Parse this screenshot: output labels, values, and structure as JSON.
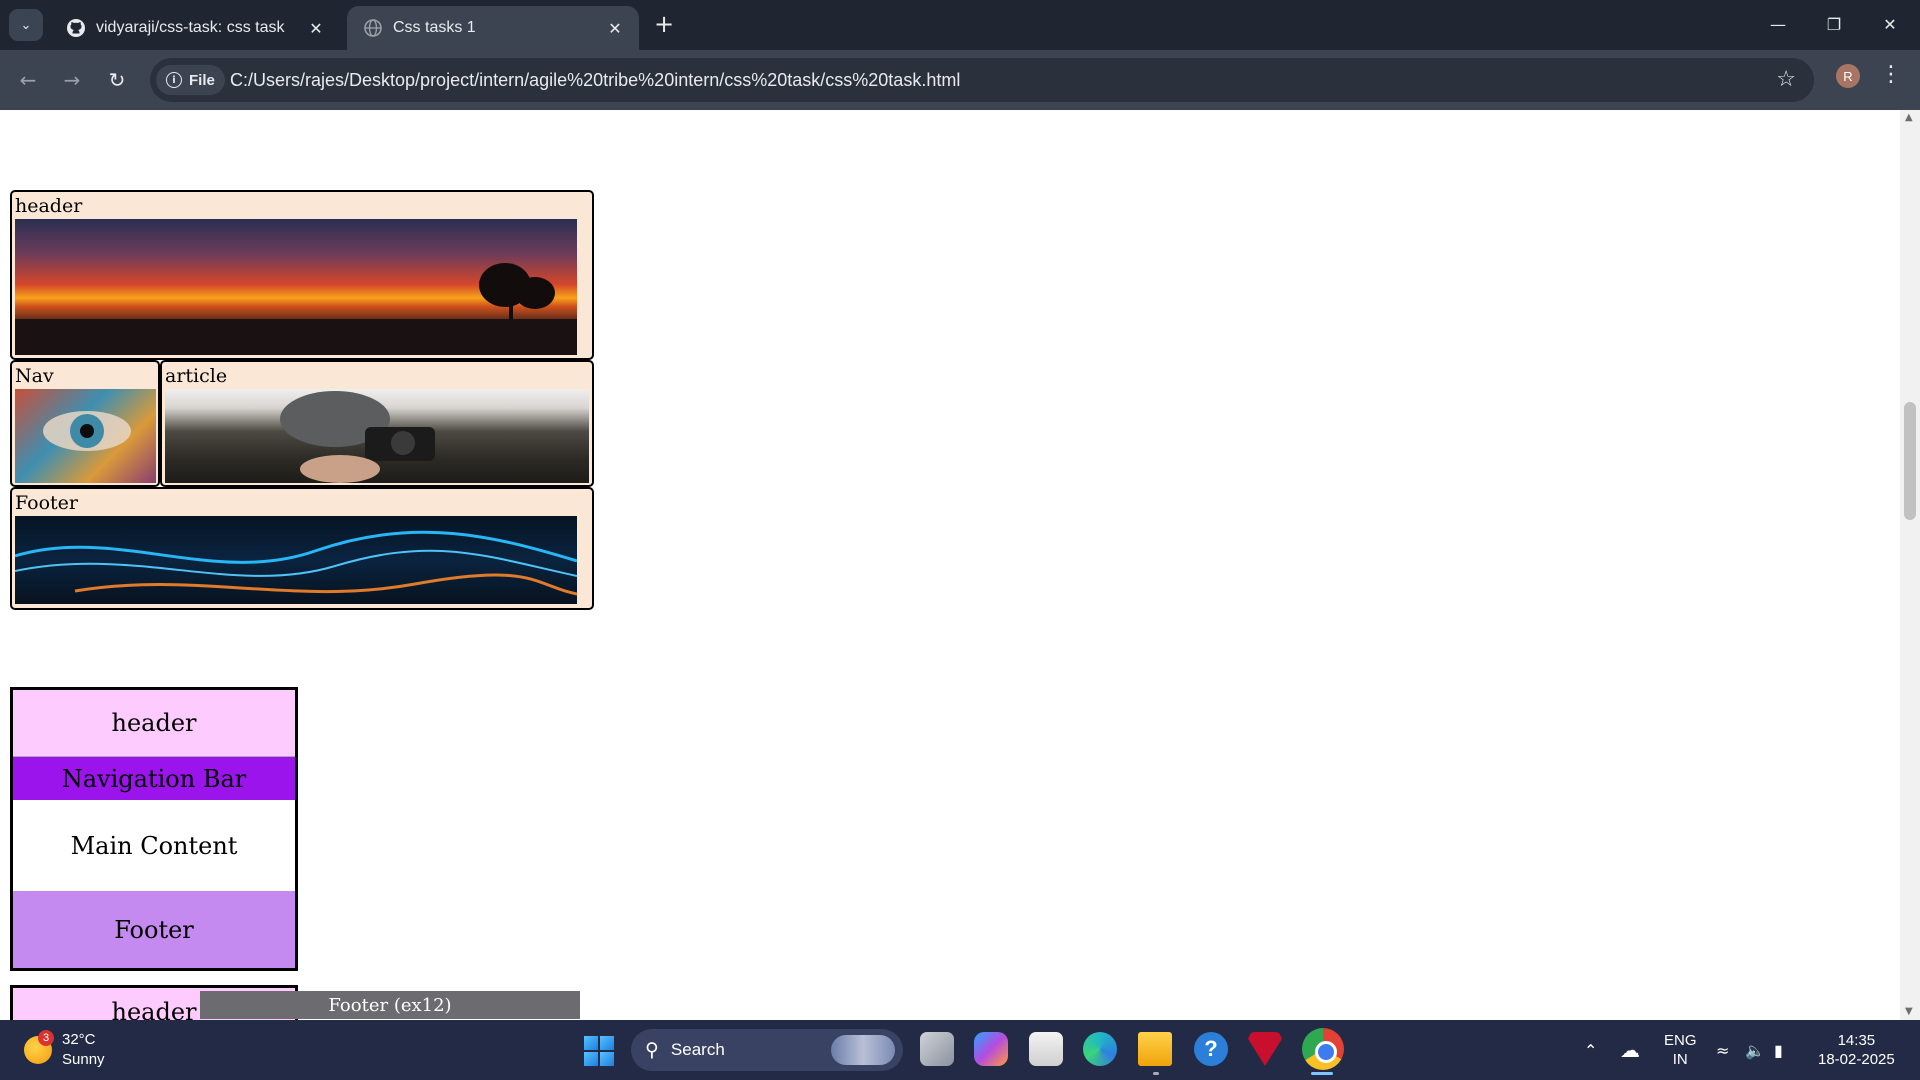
{
  "browser": {
    "tabs": [
      {
        "title": "vidyaraji/css-task: css task",
        "icon": "github-icon",
        "active": false
      },
      {
        "title": "Css tasks 1",
        "icon": "globe-icon",
        "active": true
      }
    ],
    "url_chip": "File",
    "url": "C:/Users/rajes/Desktop/project/intern/agile%20tribe%20intern/css%20task/css%20task.html",
    "profile_initial": "R"
  },
  "page": {
    "layout1": {
      "header_label": "header",
      "nav_label": "Nav",
      "article_label": "article",
      "footer_label": "Footer"
    },
    "layout2": {
      "header": "header",
      "nav": "Navigation Bar",
      "main": "Main Content",
      "footer": "Footer"
    },
    "layout3": {
      "header": "header",
      "footer": "Footer (ex12)"
    }
  },
  "taskbar": {
    "weather_temp": "32°C",
    "weather_desc": "Sunny",
    "weather_badge": "3",
    "search_label": "Search",
    "lang_line1": "ENG",
    "lang_line2": "IN",
    "time": "14:35",
    "date": "18-02-2025"
  },
  "colors": {
    "layout1_cell_bg": "#fbe7d6",
    "layout2_header_bg": "#fecbfe",
    "layout2_nav_bg": "#9b14ec",
    "layout2_footer_bg": "#c48af0",
    "footer12_bg": "#6c6c70"
  }
}
